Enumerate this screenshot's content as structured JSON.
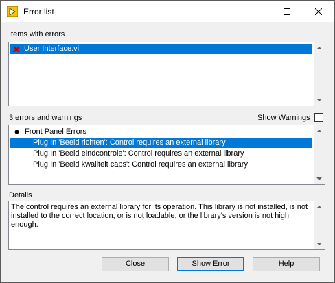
{
  "window": {
    "title": "Error list",
    "controls": {
      "minimize": "minimize-icon",
      "maximize": "maximize-icon",
      "close": "close-icon"
    }
  },
  "items_section": {
    "label": "Items with errors",
    "items": [
      {
        "label": "User Interface.vi",
        "selected": true,
        "icon": "error-x-icon"
      }
    ]
  },
  "errors_section": {
    "label": "3 errors and warnings",
    "show_warnings_label": "Show Warnings",
    "show_warnings_checked": false,
    "group_label": "Front Panel Errors",
    "entries": [
      {
        "label": "Plug In 'Beeld richten': Control requires an external library",
        "selected": true
      },
      {
        "label": "Plug In 'Beeld eindcontrole': Control requires an external library",
        "selected": false
      },
      {
        "label": "Plug In 'Beeld kwaliteit caps': Control requires an external library",
        "selected": false
      }
    ]
  },
  "details_section": {
    "label": "Details",
    "text": "The control requires an external library for its operation. This library is not installed, is not installed to the correct location, or is not loadable, or the library's version is not high enough."
  },
  "buttons": {
    "close": "Close",
    "show_error": "Show Error",
    "help": "Help"
  },
  "colors": {
    "selection": "#0078d7",
    "error_x": "#c00000"
  }
}
